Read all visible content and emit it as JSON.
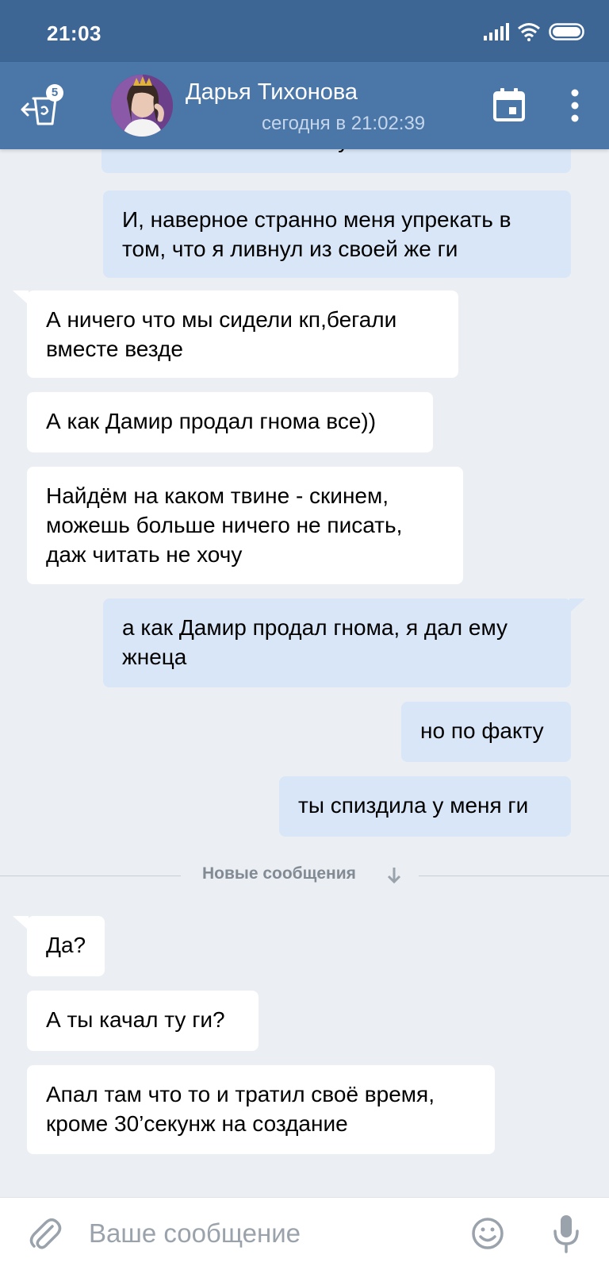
{
  "status_bar": {
    "time": "21:03"
  },
  "header": {
    "unread_badge": "5",
    "contact_name": "Дарья Тихонова",
    "last_seen": "сегодня в 21:02:39"
  },
  "messages": [
    {
      "direction": "out",
      "text": "мо скинешь мне главу на вампа ?"
    },
    {
      "direction": "out",
      "text": "И, наверное странно меня упрекать в том, что я ливнул из своей же ги"
    },
    {
      "direction": "in",
      "text": "А ничего что мы сидели кп,бегали вместе везде"
    },
    {
      "direction": "in",
      "text": "А как Дамир продал гнома все))"
    },
    {
      "direction": "in",
      "text": "Найдём на каком твине - скинем, можешь больше ничего не писать, даж читать не хочу"
    },
    {
      "direction": "out",
      "text": "а как Дамир продал гнома, я дал ему жнеца"
    },
    {
      "direction": "out",
      "text": "но по факту"
    },
    {
      "direction": "out",
      "text": "ты спиздила у меня ги"
    },
    {
      "direction": "in",
      "text": "Да?"
    },
    {
      "direction": "in",
      "text": "А ты качал ту ги?"
    },
    {
      "direction": "in",
      "text": "Апал там что то и тратил своё время, кроме 30’секунж на создание"
    }
  ],
  "divider": {
    "label": "Новые сообщения"
  },
  "composer": {
    "placeholder": "Ваше сообщение"
  },
  "colors": {
    "status_bar": "#3d6695",
    "header": "#4a76a8",
    "outgoing_bubble": "#d8e6f7",
    "incoming_bubble": "#ffffff",
    "background": "#ebeef3"
  }
}
